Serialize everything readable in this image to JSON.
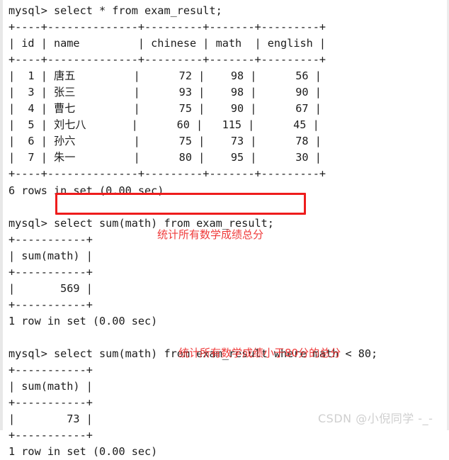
{
  "terminal": {
    "prompt": "mysql> ",
    "lines": [
      "mysql> select * from exam_result;",
      "+----+--------------+---------+-------+---------+",
      "| id | name         | chinese | math  | english |",
      "+----+--------------+---------+-------+---------+",
      "|  1 | 唐五         |      72 |    98 |      56 |",
      "|  3 | 张三         |      93 |    98 |      90 |",
      "|  4 | 曹七         |      75 |    90 |      67 |",
      "|  5 | 刘七八       |      60 |   115 |      45 |",
      "|  6 | 孙六         |      75 |    73 |      78 |",
      "|  7 | 朱一         |      80 |    95 |      30 |",
      "+----+--------------+---------+-------+---------+",
      "6 rows in set (0.00 sec)",
      "",
      "mysql> select sum(math) from exam_result;",
      "+-----------+",
      "| sum(math) |",
      "+-----------+",
      "|       569 |",
      "+-----------+",
      "1 row in set (0.00 sec)",
      "",
      "mysql> select sum(math) from exam_result where math < 80;",
      "+-----------+",
      "| sum(math) |",
      "+-----------+",
      "|        73 |",
      "+-----------+",
      "1 row in set (0.00 sec)"
    ],
    "queries": [
      "select * from exam_result;",
      "select sum(math) from exam_result;",
      "select sum(math) from exam_result where math < 80;"
    ],
    "table": {
      "name": "exam_result",
      "columns": [
        "id",
        "name",
        "chinese",
        "math",
        "english"
      ],
      "rows": [
        [
          "1",
          "唐五",
          "72",
          "98",
          "56"
        ],
        [
          "3",
          "张三",
          "93",
          "98",
          "90"
        ],
        [
          "4",
          "曹七",
          "75",
          "90",
          "67"
        ],
        [
          "5",
          "刘七八",
          "60",
          "115",
          "45"
        ],
        [
          "6",
          "孙六",
          "75",
          "73",
          "78"
        ],
        [
          "7",
          "朱一",
          "80",
          "95",
          "30"
        ]
      ],
      "row_count_status": "6 rows in set (0.00 sec)"
    },
    "results": [
      {
        "column": "sum(math)",
        "value": "569",
        "status": "1 row in set (0.00 sec)"
      },
      {
        "column": "sum(math)",
        "value": "73",
        "status": "1 row in set (0.00 sec)"
      }
    ]
  },
  "annotations": [
    {
      "text": "统计所有数学成绩总分",
      "color": "#ef3b3b"
    },
    {
      "text": "统计所有数学成绩小于80分的总分",
      "color": "#ef3b3b"
    }
  ],
  "highlight_box": {
    "color": "#ee1c1c",
    "target_query": "select sum(math) from exam_result;"
  },
  "watermark": {
    "text": "CSDN @小倪同学 -_-",
    "color": "#cfcfcf"
  }
}
